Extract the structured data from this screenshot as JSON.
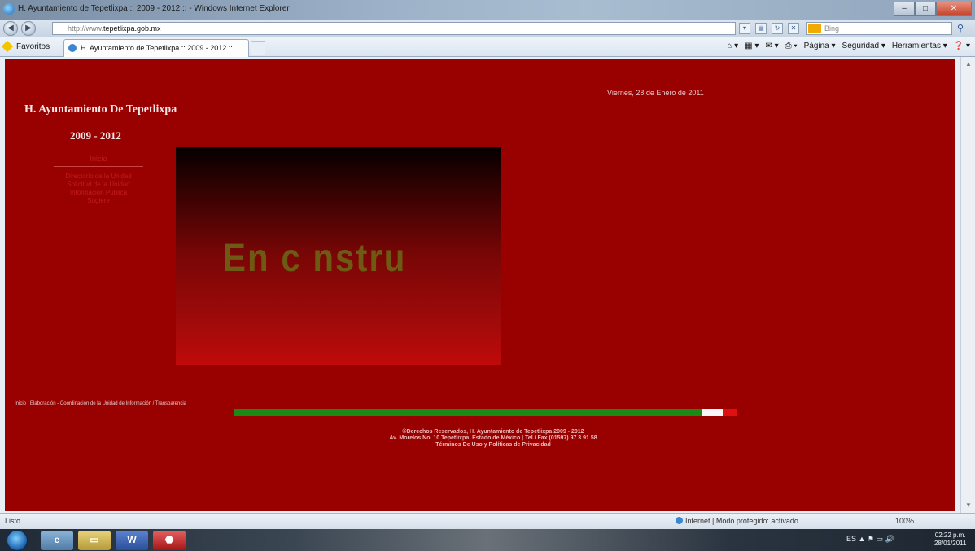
{
  "window": {
    "title": "H. Ayuntamiento de Tepetlixpa :: 2009 - 2012 :: - Windows Internet Explorer",
    "controls": {
      "minimize": "–",
      "maximize": "□",
      "close": "✕"
    }
  },
  "address_bar": {
    "url_prefix": "http://www.",
    "url_host": "tepetlixpa.gob.mx",
    "search_placeholder": "Bing",
    "back_icon": "back-arrow-icon",
    "forward_icon": "forward-arrow-icon"
  },
  "favorites_bar": {
    "label": "Favoritos",
    "tab_title": "H. Ayuntamiento de Tepetlixpa :: 2009 - 2012 ::",
    "command_items": [
      "Página ▾",
      "Seguridad ▾",
      "Herramientas ▾",
      "❓ ▾"
    ]
  },
  "page": {
    "date": "Viernes, 28 de Enero de 2011",
    "site_title": "H. Ayuntamiento De Tepetlixpa",
    "site_years": "2009 - 2012",
    "menu_heading": "Inicio",
    "menu_links": [
      "Directorio de la Unidad",
      "Solicitud de la Unidad",
      "Información Pública",
      "Sugiere"
    ],
    "banner_text": "En c  nstru",
    "bottom_links": "Inicio | Elaboración - Coordinación de la Unidad de Información / Transparencia",
    "flag_colors": {
      "green": "#1b8a15",
      "white": "#f7f7f7",
      "red": "#e01010"
    },
    "footer_lines": [
      "©Derechos Reservados, H. Ayuntamiento de Tepetlixpa 2009 - 2012",
      "Av. Morelos No. 10 Tepetlixpa, Estado de México | Tel / Fax (01597) 97 3 91 58",
      "Términos De Uso y Políticas de Privacidad"
    ],
    "background_color": "#990000"
  },
  "status_bar": {
    "left": "Listo",
    "zone": "Internet | Modo protegido: activado",
    "zoom": "100%"
  },
  "taskbar": {
    "tray": "ES  ▲  ⚑  ▭  🔊",
    "clock_time": "02:22 p.m.",
    "clock_date": "28/01/2011"
  }
}
